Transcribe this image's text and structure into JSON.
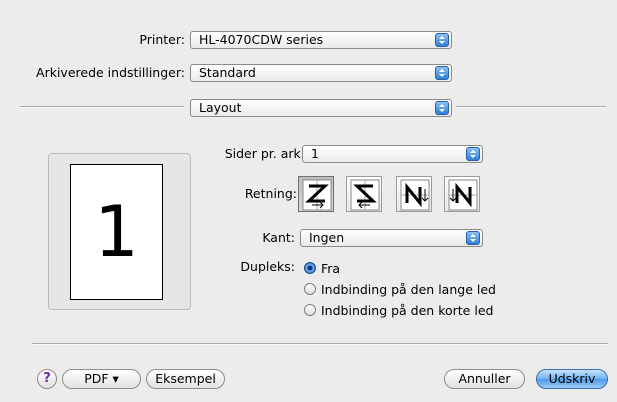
{
  "printer": {
    "label": "Printer:",
    "value": "HL-4070CDW series"
  },
  "presets": {
    "label": "Arkiverede indstillinger:",
    "value": "Standard"
  },
  "panel": {
    "value": "Layout"
  },
  "preview": {
    "page_number": "1"
  },
  "pages_per_sheet": {
    "label": "Sider pr. ark:",
    "value": "1"
  },
  "orientation": {
    "label": "Retning:",
    "selected_index": 0,
    "options": [
      "Z",
      "S",
      "N-reversed",
      "N"
    ]
  },
  "border": {
    "label": "Kant:",
    "value": "Ingen"
  },
  "duplex": {
    "label": "Dupleks:",
    "options": [
      "Fra",
      "Indbinding på den lange led",
      "Indbinding på den korte led"
    ],
    "selected_index": 0
  },
  "buttons": {
    "help": "?",
    "pdf": "PDF ▾",
    "preview": "Eksempel",
    "cancel": "Annuller",
    "print": "Udskriv"
  },
  "colors": {
    "accent": "#4e98e6",
    "background": "#ececec"
  },
  "icons": [
    "chevron-updown-icon",
    "help-icon",
    "radio-selected-icon",
    "radio-empty-icon"
  ]
}
